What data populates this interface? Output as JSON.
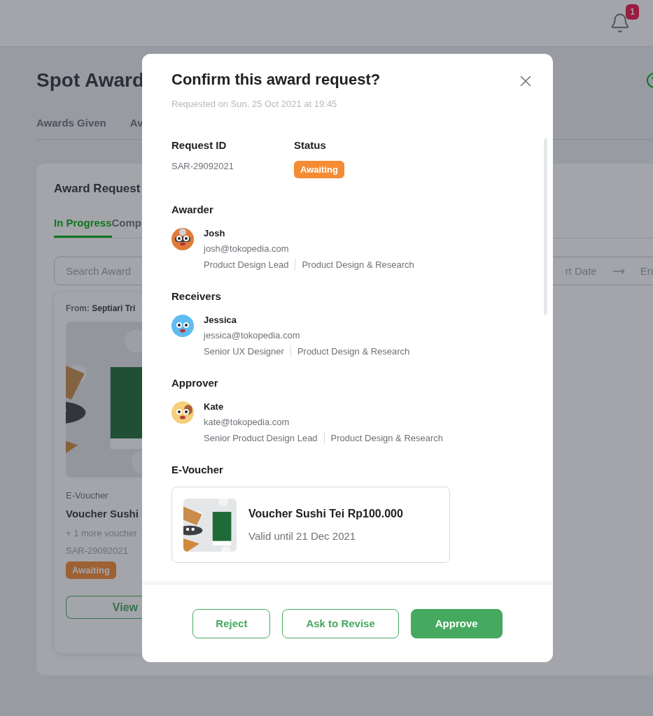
{
  "page": {
    "notifications": {
      "count": "1"
    },
    "title": "Spot Award",
    "tabs": [
      {
        "label": "Awards Given",
        "selected": false
      },
      {
        "label": "Av",
        "selected": false
      }
    ]
  },
  "requests_panel": {
    "title": "Award Request",
    "tabs": [
      {
        "label": "In Progress",
        "selected": true
      },
      {
        "label": "Comp",
        "selected": false
      }
    ],
    "search": {
      "placeholder": "Search Award"
    },
    "date_range": {
      "start_placeholder": "rt Date",
      "end_placeholder": "En"
    },
    "card": {
      "from_label": "From:",
      "from_name": "Septiari Tri",
      "type": "E-Voucher",
      "name": "Voucher Sushi",
      "more": "+ 1 more voucher",
      "id": "SAR-29092021",
      "status": "Awaiting",
      "button": "View"
    }
  },
  "modal": {
    "title": "Confirm this award request?",
    "requested_on": "Requested on Sun, 25 Oct 2021 at 19:45",
    "request_id": {
      "label": "Request ID",
      "value": "SAR-29092021"
    },
    "status": {
      "label": "Status",
      "value": "Awaiting"
    },
    "sections": [
      {
        "title": "Awarder",
        "people": [
          {
            "name": "Josh",
            "email": "josh@tokopedia.com",
            "role": "Product Design Lead",
            "department": "Product Design & Research",
            "kind": "raccoon"
          }
        ]
      },
      {
        "title": "Receivers",
        "people": [
          {
            "name": "Jessica",
            "email": "jessica@tokopedia.com",
            "role": "Senior UX Designer",
            "department": "Product Design & Research",
            "kind": "blue"
          }
        ]
      },
      {
        "title": "Approver",
        "people": [
          {
            "name": "Kate",
            "email": "kate@tokopedia.com",
            "role": "Senior Product Design Lead",
            "department": "Product Design & Research",
            "kind": "dog"
          }
        ]
      }
    ],
    "voucher": {
      "title": "E-Voucher",
      "name": "Voucher Sushi Tei Rp100.000",
      "valid": "Valid until 21 Dec 2021"
    },
    "buttons": [
      {
        "label": "Reject",
        "kind": "outline"
      },
      {
        "label": "Ask to Revise",
        "kind": "outline"
      },
      {
        "label": "Approve",
        "kind": "primary"
      }
    ]
  }
}
